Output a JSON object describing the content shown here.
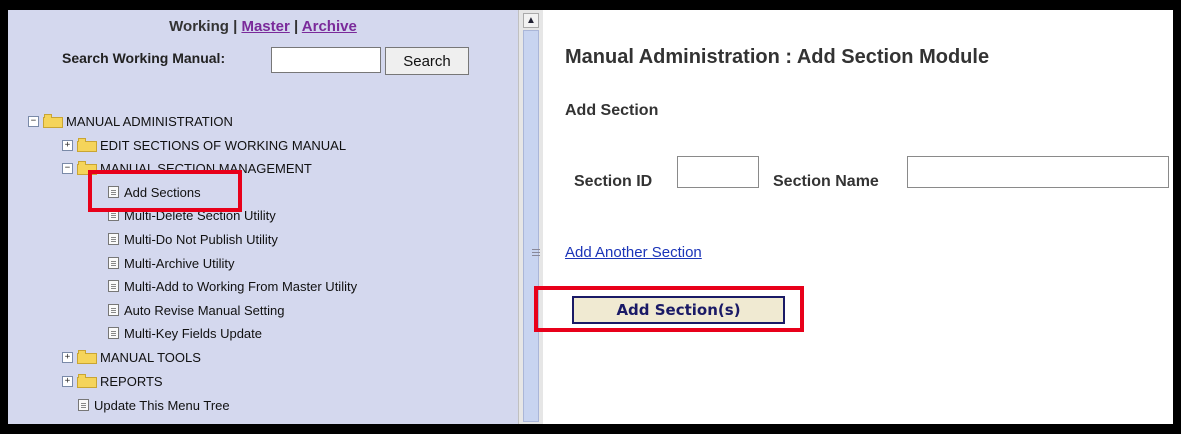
{
  "nav": {
    "working": "Working",
    "sep1": " | ",
    "master": "Master",
    "sep2": " | ",
    "archive": "Archive"
  },
  "search": {
    "label": "Search Working Manual:",
    "value": "",
    "button": "Search"
  },
  "tree": {
    "root": "MANUAL ADMINISTRATION",
    "edit_sections": "EDIT SECTIONS OF WORKING MANUAL",
    "section_mgmt": "MANUAL SECTION MANAGEMENT",
    "items": [
      "Add Sections",
      "Multi-Delete Section Utility",
      "Multi-Do Not Publish Utility",
      "Multi-Archive Utility",
      "Multi-Add to Working From Master Utility",
      "Auto Revise Manual Setting",
      "Multi-Key Fields Update"
    ],
    "manual_tools": "MANUAL TOOLS",
    "reports": "REPORTS",
    "update_tree": "Update This Menu Tree",
    "expanded_symbol": "−",
    "collapsed_symbol": "+"
  },
  "main": {
    "title": "Manual Administration : Add Section Module",
    "subtitle": "Add Section",
    "section_id_label": "Section ID",
    "section_id_value": "",
    "section_name_label": "Section Name",
    "section_name_value": "",
    "add_another_link": "Add Another Section",
    "submit_button": "Add Section(s)"
  },
  "colors": {
    "left_panel_bg": "#d4d8ee",
    "link_purple": "#7a2a9a",
    "link_blue": "#1b34b8",
    "highlight_red": "#e8001a"
  },
  "icons": {
    "scroll_up": "▲"
  }
}
